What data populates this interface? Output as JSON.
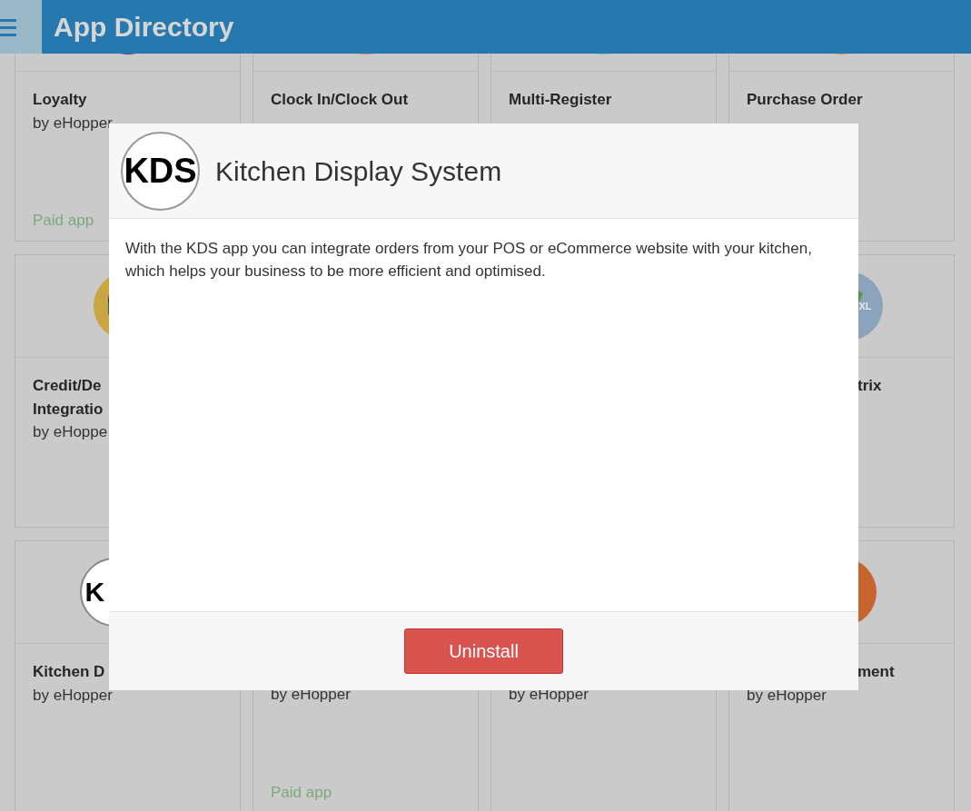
{
  "header": {
    "title": "App Directory"
  },
  "cards": [
    {
      "title": "Loyalty",
      "byline": "by eHopper",
      "paid_label": "Paid app",
      "icon": {
        "kind": "circle",
        "color": "#6b3a8e"
      }
    },
    {
      "title": "Clock In/Clock Out",
      "icon": {
        "kind": "circle",
        "color": "#d88a75"
      }
    },
    {
      "title": "Multi-Register",
      "icon": {
        "kind": "circle",
        "color": "#8bb6cf"
      }
    },
    {
      "title": "Purchase Order",
      "icon": {
        "kind": "circle",
        "color": "#d69a45"
      }
    },
    {
      "title": "Credit/De\nIntegratio",
      "byline": "by eHoppe",
      "icon": {
        "kind": "card",
        "color": "#c9a642"
      }
    },
    {
      "title": "trix",
      "title_tail": true,
      "icon": {
        "kind": "shirt",
        "color": "#8ba3bd",
        "text": "XL"
      }
    },
    {
      "title": "Kitchen D",
      "byline": "by eHopper",
      "icon": {
        "kind": "logo",
        "color": "#ffffff",
        "text": "K"
      }
    },
    {
      "byline": "by eHopper",
      "paid_label": "Paid app"
    },
    {
      "byline": "by eHopper"
    },
    {
      "title": "ment",
      "title_tail": true,
      "byline": "by eHopper",
      "icon": {
        "kind": "circle",
        "color": "#c8642f"
      }
    }
  ],
  "modal": {
    "logo": "KDS",
    "title": "Kitchen Display System",
    "description": "With the KDS app you can integrate orders from your POS or eCommerce website with your kitchen, which helps your business to be more efficient and optimised.",
    "button": "Uninstall"
  }
}
